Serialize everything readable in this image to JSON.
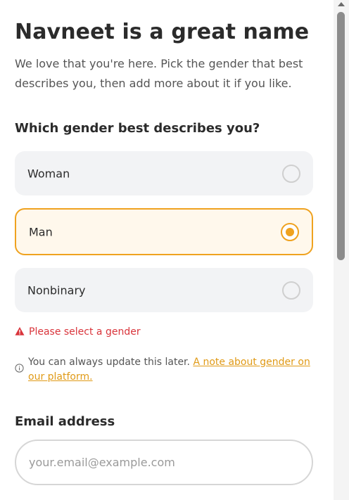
{
  "header": {
    "title": "Navneet is a great name",
    "subtitle": "We love that you're here. Pick the gender that best describes you, then add more about it if you like."
  },
  "gender": {
    "question": "Which gender best describes you?",
    "options": [
      {
        "label": "Woman",
        "selected": false
      },
      {
        "label": "Man",
        "selected": true
      },
      {
        "label": "Nonbinary",
        "selected": false
      }
    ],
    "error": "Please select a gender",
    "info_text": "You can always update this later.",
    "info_link": "A note about gender on our platform."
  },
  "email": {
    "label": "Email address",
    "placeholder": "your.email@example.com",
    "value": ""
  },
  "colors": {
    "accent": "#efa21f",
    "error": "#d9343b",
    "option_bg": "#f2f3f5"
  }
}
